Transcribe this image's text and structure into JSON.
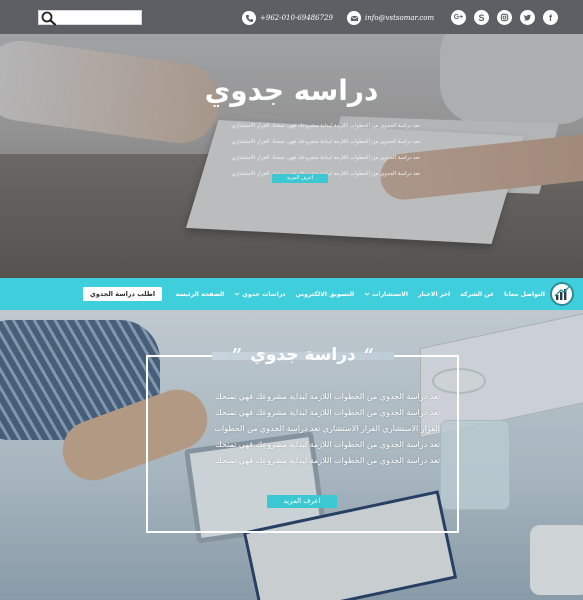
{
  "topbar": {
    "search": {
      "placeholder": ""
    },
    "phone": "+962-010-69486729",
    "email": "info@vstsomar.com",
    "socials": [
      {
        "name": "google-plus",
        "label": "G+"
      },
      {
        "name": "skype",
        "label": "S"
      },
      {
        "name": "instagram",
        "label": ""
      },
      {
        "name": "twitter",
        "label": ""
      },
      {
        "name": "facebook",
        "label": "f"
      }
    ],
    "bg_color": "#5d5f64"
  },
  "hero": {
    "title": "دراسه جدوي",
    "lines": [
      "تعد دراسة الجدوي من الخطوات اللازمة لبداية مشروعك فهي تمنحك القرار الاستشاري",
      "تعد دراسة الجدوي من الخطوات اللازمة لبداية مشروعك فهي تمنحك القرار الاستشاري",
      "تعد دراسة الجدوي من الخطوات اللازمة لبداية مشروعك فهي تمنحك القرار الاستشاري",
      "تعد دراسة الجدوي من الخطوات اللازمة لبداية مشروعك فهي تمنحك القرار الاستشاري"
    ],
    "button": "اعرف المزيد"
  },
  "nav": {
    "order_button": "اطلب دراسة الجدوي",
    "links": [
      {
        "label": "الصفحة الرئيسة",
        "dropdown": false
      },
      {
        "label": "دراسات جدوي",
        "dropdown": true
      },
      {
        "label": "التسويق الالكتروني",
        "dropdown": false
      },
      {
        "label": "الاستشارات",
        "dropdown": true
      },
      {
        "label": "اخر الاخبار",
        "dropdown": false
      },
      {
        "label": "عن الشركة",
        "dropdown": false
      },
      {
        "label": "التواصل معانا",
        "dropdown": false
      }
    ],
    "accent_color": "#3fcedb"
  },
  "feature": {
    "title": "دراسة جدوي",
    "open_quote": "“",
    "close_quote": "”",
    "lines": [
      "تعد دراسة الجدوي من الخطوات اللازمة لبداية مشروعك فهي تمنحك",
      "تعد دراسة الجدوي من الخطوات اللازمة لبداية مشروعك فهي تمنحك",
      "القرار الاستشاري القرار الاستشاري تعد دراسة الجدوي من الخطوات",
      "تعد دراسة الجدوي من الخطوات اللازمة لبداية مشروعك فهي تمنحك",
      "تعد دراسة الجدوي من الخطوات اللازمة لبداية مشروعك فهي تمنحك"
    ],
    "button": "اعرف المزيد",
    "button_color": "#3bc8d2"
  }
}
